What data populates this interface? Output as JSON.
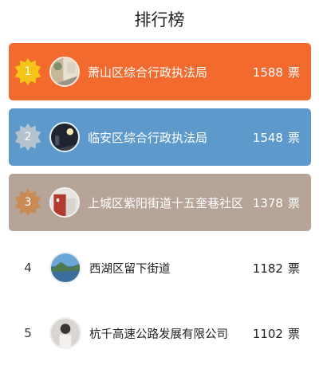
{
  "header": {
    "title": "排行榜"
  },
  "ranking": [
    {
      "rank": "1",
      "name": "萧山区综合行政执法局",
      "votes": "1588",
      "unit": "票",
      "bg": "#F26A2E",
      "badge": "#F5C518",
      "avatar": "avatar-photo-street-icon"
    },
    {
      "rank": "2",
      "name": "临安区综合行政执法局",
      "votes": "1548",
      "unit": "票",
      "bg": "#5D9ACB",
      "badge": "#B5C3CF",
      "avatar": "avatar-photo-night-icon"
    },
    {
      "rank": "3",
      "name": "上城区紫阳街道十五奎巷社区",
      "votes": "1378",
      "unit": "票",
      "bg": "#B5A497",
      "badge": "#C98A55",
      "avatar": "avatar-photo-building-icon"
    },
    {
      "rank": "4",
      "name": "西湖区留下街道",
      "votes": "1182",
      "unit": "票",
      "bg": "#FFFFFF",
      "avatar": "avatar-photo-river-icon"
    },
    {
      "rank": "5",
      "name": "杭千高速公路发展有限公司",
      "votes": "1102",
      "unit": "票",
      "bg": "#FFFFFF",
      "avatar": "avatar-photo-person-icon"
    }
  ]
}
